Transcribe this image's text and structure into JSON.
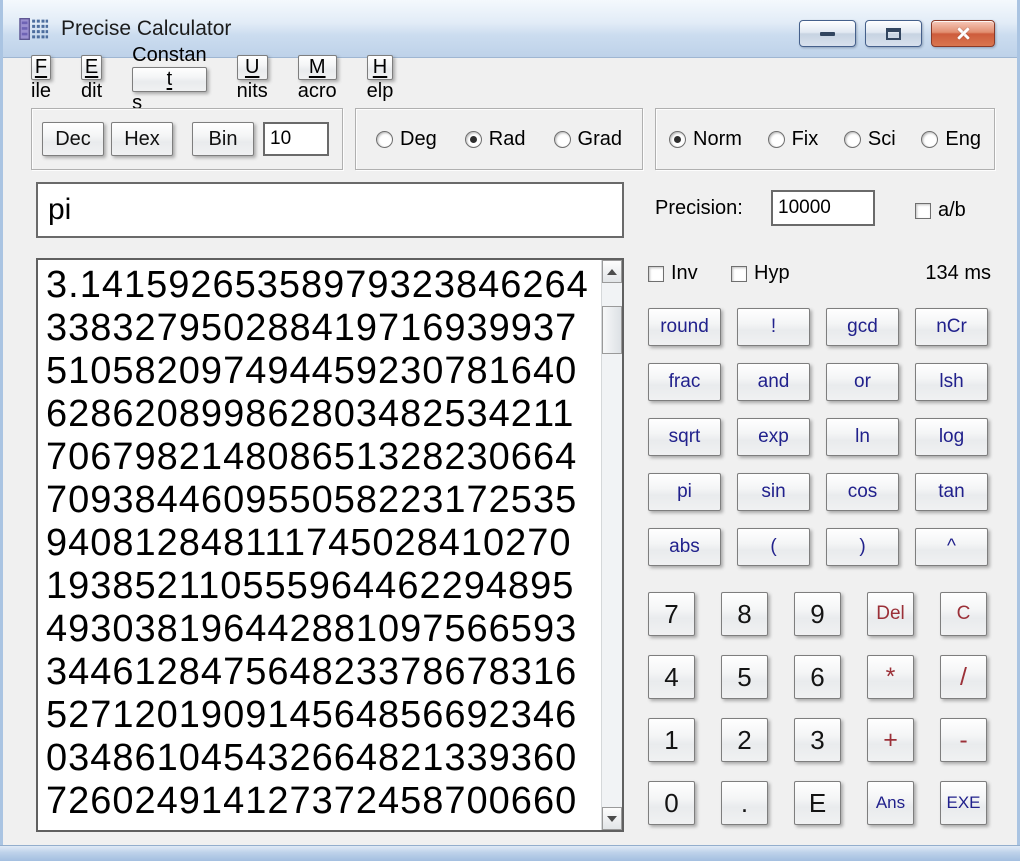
{
  "window": {
    "title": "Precise Calculator"
  },
  "menu": {
    "items": [
      {
        "pre": "",
        "key": "F",
        "post": "ile"
      },
      {
        "pre": "",
        "key": "E",
        "post": "dit"
      },
      {
        "pre": "Constan",
        "key": "t",
        "post": "s"
      },
      {
        "pre": "",
        "key": "U",
        "post": "nits"
      },
      {
        "pre": "",
        "key": "M",
        "post": "acro"
      },
      {
        "pre": "",
        "key": "H",
        "post": "elp"
      }
    ]
  },
  "base": {
    "dec_label": "Dec",
    "hex_label": "Hex",
    "bin_label": "Bin",
    "value": "10"
  },
  "angle": {
    "options": [
      {
        "label": "Deg",
        "selected": false
      },
      {
        "label": "Rad",
        "selected": true
      },
      {
        "label": "Grad",
        "selected": false
      }
    ],
    "selected": "Rad"
  },
  "format": {
    "options": [
      {
        "label": "Norm",
        "selected": true
      },
      {
        "label": "Fix",
        "selected": false
      },
      {
        "label": "Sci",
        "selected": false
      },
      {
        "label": "Eng",
        "selected": false
      }
    ],
    "selected": "Norm"
  },
  "expression": {
    "value": "pi"
  },
  "result": {
    "lines": [
      "3.14159265358979323846264",
      "338327950288419716939937",
      "510582097494459230781640",
      "628620899862803482534211",
      "706798214808651328230664",
      "709384460955058223172535",
      "940812848111745028410270",
      "193852110555964462294895",
      "493038196442881097566593",
      "344612847564823378678316",
      "527120190914564856692346",
      "034861045432664821339360",
      "726024914127372458700660"
    ]
  },
  "precision": {
    "label": "Precision:",
    "value": "10000"
  },
  "checkboxes": {
    "ab": {
      "label": "a/b",
      "checked": false
    },
    "inv": {
      "label": "Inv",
      "checked": false
    },
    "hyp": {
      "label": "Hyp",
      "checked": false
    }
  },
  "status": {
    "time": "134 ms"
  },
  "function_keys": [
    [
      "round",
      "!",
      "gcd",
      "nCr"
    ],
    [
      "frac",
      "and",
      "or",
      "lsh"
    ],
    [
      "sqrt",
      "exp",
      "ln",
      "log"
    ],
    [
      "pi",
      "sin",
      "cos",
      "tan"
    ],
    [
      "abs",
      "(",
      ")",
      "^"
    ]
  ],
  "numpad": [
    [
      "7",
      "8",
      "9",
      "Del",
      "C"
    ],
    [
      "4",
      "5",
      "6",
      "*",
      "/"
    ],
    [
      "1",
      "2",
      "3",
      "+",
      "-"
    ],
    [
      "0",
      ".",
      "E",
      "Ans",
      "EXE"
    ]
  ],
  "colors": {
    "function_key_text": "#21218c",
    "operator_key_text": "#9b3038",
    "number_key_text": "#141414",
    "titlebar_top": "#f4f9fd",
    "titlebar_bottom": "#bed2e9",
    "close_button": "#cd5c3c",
    "window_border": "#aac4e2"
  }
}
